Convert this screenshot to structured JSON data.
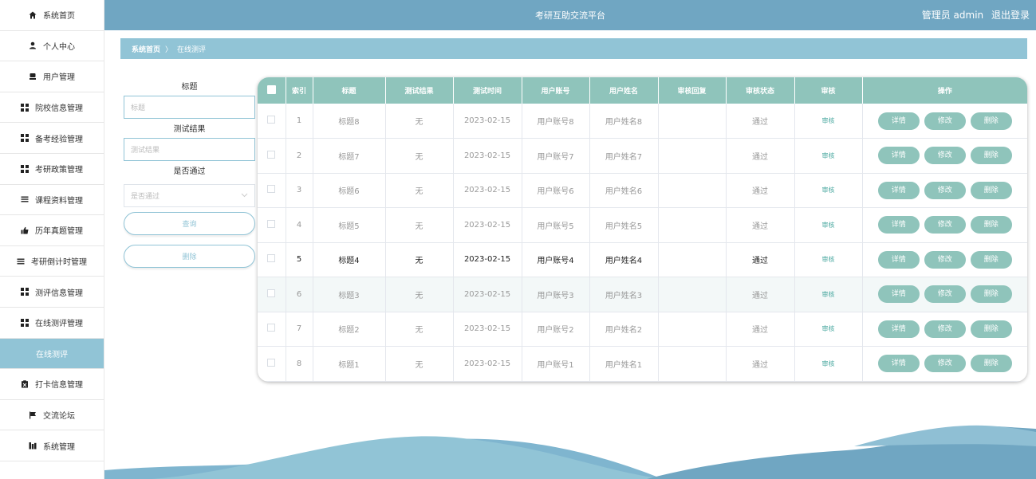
{
  "sidebar": {
    "items": [
      {
        "label": "系统首页",
        "icon": "home-icon"
      },
      {
        "label": "个人中心",
        "icon": "user-icon"
      },
      {
        "label": "用户管理",
        "icon": "users-icon"
      },
      {
        "label": "院校信息管理",
        "icon": "grid-icon"
      },
      {
        "label": "备考经验管理",
        "icon": "grid-icon"
      },
      {
        "label": "考研政策管理",
        "icon": "grid-icon"
      },
      {
        "label": "课程资料管理",
        "icon": "list-icon"
      },
      {
        "label": "历年真题管理",
        "icon": "like-icon"
      },
      {
        "label": "考研倒计时管理",
        "icon": "list-icon"
      },
      {
        "label": "测评信息管理",
        "icon": "grid-icon"
      },
      {
        "label": "在线测评管理",
        "icon": "grid-icon"
      },
      {
        "label": "在线测评",
        "icon": ""
      },
      {
        "label": "打卡信息管理",
        "icon": "clipboard-icon"
      },
      {
        "label": "交流论坛",
        "icon": "flag-icon"
      },
      {
        "label": "系统管理",
        "icon": "chart-icon"
      }
    ]
  },
  "header": {
    "title": "考研互助交流平台",
    "user_label": "管理员 admin",
    "logout": "退出登录"
  },
  "breadcrumb": {
    "home": "系统首页",
    "separator": "〉",
    "current": "在线测评"
  },
  "search": {
    "title_label": "标题",
    "title_placeholder": "标题",
    "result_label": "测试结果",
    "result_placeholder": "测试结果",
    "pass_label": "是否通过",
    "pass_placeholder": "是否通过",
    "query_button": "查询",
    "delete_button": "删除"
  },
  "table": {
    "headers": [
      "索引",
      "标题",
      "测试结果",
      "测试时间",
      "用户账号",
      "用户姓名",
      "审核回复",
      "审核状态",
      "审核",
      "操作"
    ],
    "rows": [
      {
        "index": "1",
        "title": "标题8",
        "result": "无",
        "time": "2023-02-15",
        "account": "用户账号8",
        "name": "用户姓名8",
        "reply": "",
        "status": "通过",
        "audit": "审核"
      },
      {
        "index": "2",
        "title": "标题7",
        "result": "无",
        "time": "2023-02-15",
        "account": "用户账号7",
        "name": "用户姓名7",
        "reply": "",
        "status": "通过",
        "audit": "审核"
      },
      {
        "index": "3",
        "title": "标题6",
        "result": "无",
        "time": "2023-02-15",
        "account": "用户账号6",
        "name": "用户姓名6",
        "reply": "",
        "status": "通过",
        "audit": "审核"
      },
      {
        "index": "4",
        "title": "标题5",
        "result": "无",
        "time": "2023-02-15",
        "account": "用户账号5",
        "name": "用户姓名5",
        "reply": "",
        "status": "通过",
        "audit": "审核"
      },
      {
        "index": "5",
        "title": "标题4",
        "result": "无",
        "time": "2023-02-15",
        "account": "用户账号4",
        "name": "用户姓名4",
        "reply": "",
        "status": "通过",
        "audit": "审核"
      },
      {
        "index": "6",
        "title": "标题3",
        "result": "无",
        "time": "2023-02-15",
        "account": "用户账号3",
        "name": "用户姓名3",
        "reply": "",
        "status": "通过",
        "audit": "审核"
      },
      {
        "index": "7",
        "title": "标题2",
        "result": "无",
        "time": "2023-02-15",
        "account": "用户账号2",
        "name": "用户姓名2",
        "reply": "",
        "status": "通过",
        "audit": "审核"
      },
      {
        "index": "8",
        "title": "标题1",
        "result": "无",
        "time": "2023-02-15",
        "account": "用户账号1",
        "name": "用户姓名1",
        "reply": "",
        "status": "通过",
        "audit": "审核"
      }
    ],
    "actions": {
      "detail": "详情",
      "edit": "修改",
      "delete": "删除"
    },
    "highlighted_row": 4,
    "alt_row": 5
  },
  "colors": {
    "header": "#70a6c2",
    "accent": "#91c4d6",
    "table_header": "#8fc4bb",
    "button": "#8fc4bb"
  }
}
